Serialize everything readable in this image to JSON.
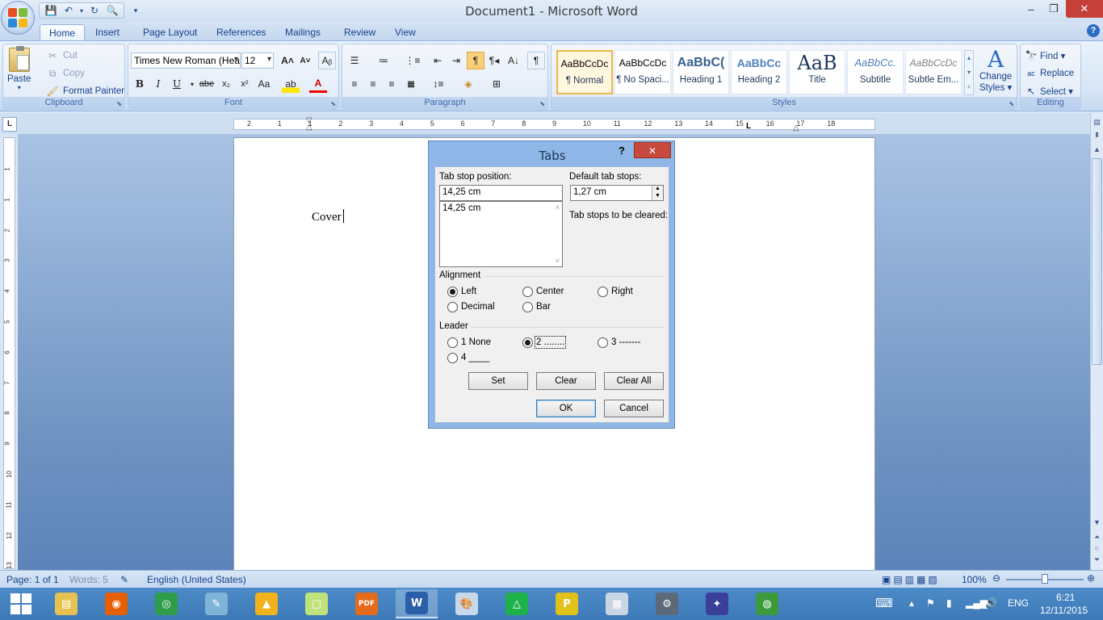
{
  "window": {
    "title": "Document1 - Microsoft Word",
    "minimize_label": "‒",
    "maximize_label": "❐",
    "close_label": "✕"
  },
  "ribbon_tabs": [
    "Home",
    "Insert",
    "Page Layout",
    "References",
    "Mailings",
    "Review",
    "View"
  ],
  "clipboard": {
    "paste": "Paste",
    "cut": "Cut",
    "copy": "Copy",
    "format_painter": "Format Painter",
    "label": "Clipboard"
  },
  "font": {
    "name": "Times New Roman (Hea",
    "size": "12",
    "label": "Font",
    "bold": "B",
    "italic": "I",
    "underline": "U",
    "strike": "abe",
    "subscript": "x₂",
    "superscript": "x²",
    "change_case": "Aa",
    "grow": "A˄",
    "shrink": "A˅",
    "font_color": "A"
  },
  "paragraph": {
    "label": "Paragraph",
    "show_marks": "¶"
  },
  "styles": {
    "label": "Styles",
    "items": [
      {
        "preview": "AaBbCcDc",
        "name": "¶ Normal"
      },
      {
        "preview": "AaBbCcDc",
        "name": "¶ No Spaci..."
      },
      {
        "preview": "AaBbC(",
        "name": "Heading 1"
      },
      {
        "preview": "AaBbCc",
        "name": "Heading 2"
      },
      {
        "preview": "AaB",
        "name": "Title"
      },
      {
        "preview": "AaBbCc.",
        "name": "Subtitle"
      },
      {
        "preview": "AaBbCcDc",
        "name": "Subtle Em..."
      }
    ],
    "change_styles_line1": "Change",
    "change_styles_line2": "Styles ▾"
  },
  "editing": {
    "label": "Editing",
    "find": "Find ▾",
    "replace": "Replace",
    "select": "Select ▾"
  },
  "ruler": {
    "corner": "L",
    "ticks": [
      "2",
      "1",
      "1",
      "2",
      "3",
      "4",
      "5",
      "6",
      "7",
      "8",
      "9",
      "10",
      "11",
      "12",
      "13",
      "14",
      "15",
      "16",
      "17",
      "18"
    ],
    "vticks": [
      "1",
      "1",
      "2",
      "3",
      "4",
      "5",
      "6",
      "7",
      "8",
      "9",
      "10",
      "11",
      "12",
      "13",
      "14"
    ]
  },
  "document": {
    "text": "Cover"
  },
  "tabs_dialog": {
    "title": "Tabs",
    "help": "?",
    "close": "✕",
    "tab_stop_position_label": "Tab stop position:",
    "tab_stop_position_value": "14,25 cm",
    "tab_stop_list": [
      "14,25 cm"
    ],
    "default_tab_stops_label": "Default tab stops:",
    "default_tab_stops_value": "1,27 cm",
    "tab_stops_to_clear_label": "Tab stops to be cleared:",
    "alignment_label": "Alignment",
    "alignment_options": [
      "Left",
      "Center",
      "Right",
      "Decimal",
      "Bar"
    ],
    "alignment_selected": "Left",
    "leader_label": "Leader",
    "leader_options": [
      "1 None",
      "2 ........",
      "3 -------",
      "4 ____"
    ],
    "leader_selected": "2 ........",
    "set": "Set",
    "clear": "Clear",
    "clear_all": "Clear All",
    "ok": "OK",
    "cancel": "Cancel"
  },
  "statusbar": {
    "page": "Page: 1 of 1",
    "words": "Words: 5",
    "language": "English (United States)",
    "zoom": "100%"
  },
  "taskbar": {
    "lang": "ENG",
    "time": "6:21",
    "date": "12/11/2015",
    "apps": [
      {
        "name": "file-explorer-icon",
        "color": "#e8c251",
        "glyph": "▤"
      },
      {
        "name": "firefox-icon",
        "color": "#e66000",
        "glyph": "◉"
      },
      {
        "name": "chrome-icon",
        "color": "#2f9c4a",
        "glyph": "◎"
      },
      {
        "name": "notepad-icon",
        "color": "#7fb4d9",
        "glyph": "✎"
      },
      {
        "name": "aimp-icon",
        "color": "#f2b21b",
        "glyph": "▲"
      },
      {
        "name": "sticky-notes-icon",
        "color": "#bfe37a",
        "glyph": "▢"
      },
      {
        "name": "pdf-icon",
        "color": "#e66a1c",
        "glyph": "PDF"
      },
      {
        "name": "word-icon",
        "color": "#2a5ea8",
        "glyph": "W"
      },
      {
        "name": "paint-icon",
        "color": "#c7d8ea",
        "glyph": "🎨"
      },
      {
        "name": "green-triangle-icon",
        "color": "#1db34a",
        "glyph": "△"
      },
      {
        "name": "pes-icon",
        "color": "#e0c21a",
        "glyph": "P"
      },
      {
        "name": "monitor-icon",
        "color": "#c9d5e2",
        "glyph": "▦"
      },
      {
        "name": "settings-app-icon",
        "color": "#5b6978",
        "glyph": "⚙"
      },
      {
        "name": "emblem-app-icon",
        "color": "#3a3f9a",
        "glyph": "✦"
      },
      {
        "name": "globe-app-icon",
        "color": "#3c9a3c",
        "glyph": "◍"
      }
    ]
  }
}
